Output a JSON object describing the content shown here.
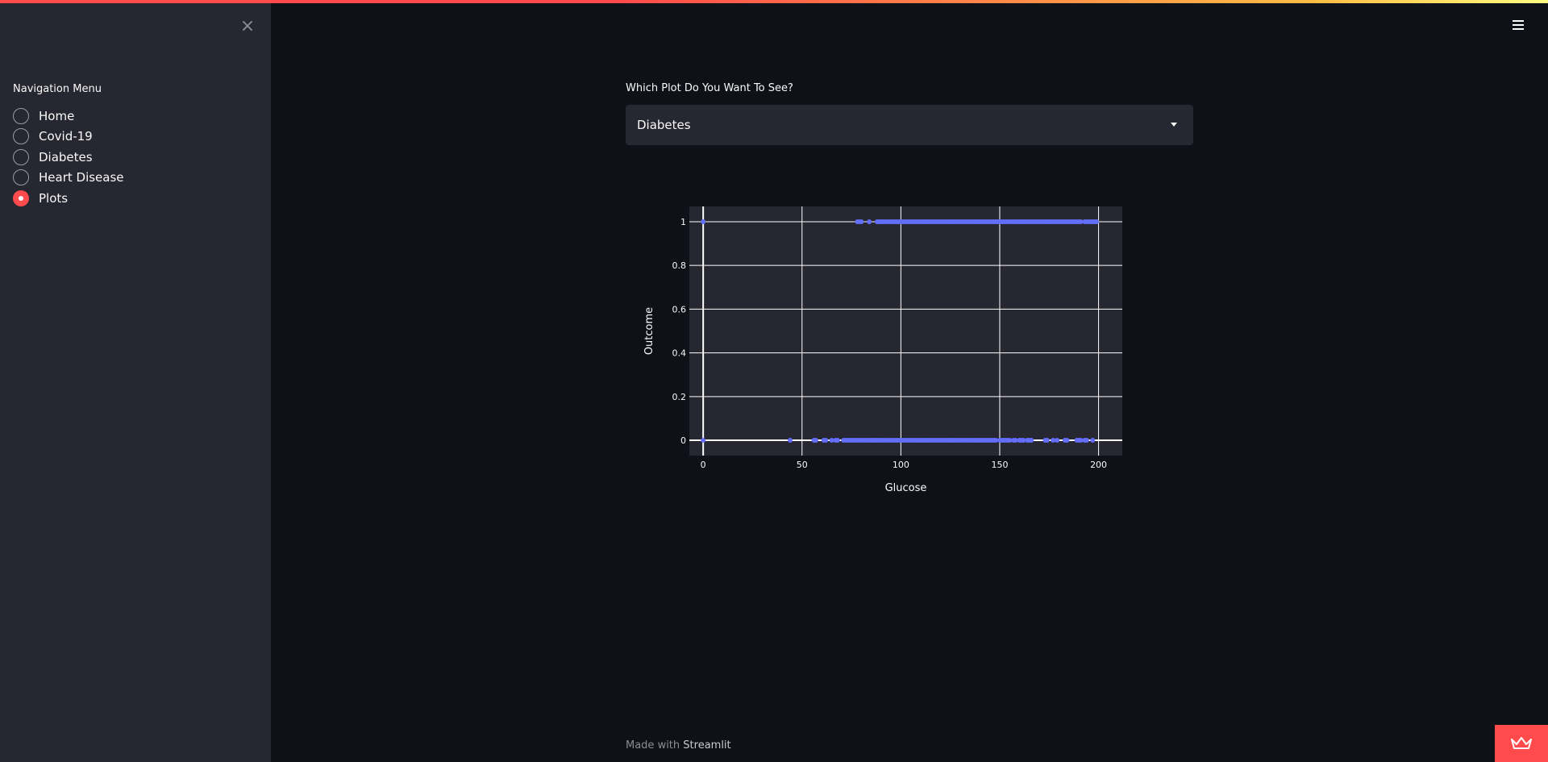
{
  "sidebar": {
    "close_glyph": "×",
    "nav_heading": "Navigation Menu",
    "items": [
      {
        "label": "Home",
        "selected": false
      },
      {
        "label": "Covid-19",
        "selected": false
      },
      {
        "label": "Diabetes",
        "selected": false
      },
      {
        "label": "Heart Disease",
        "selected": false
      },
      {
        "label": "Plots",
        "selected": true
      }
    ]
  },
  "main": {
    "select_label": "Which Plot Do You Want To See?",
    "select_value": "Diabetes"
  },
  "chart_data": {
    "type": "scatter",
    "xlabel": "Glucose",
    "ylabel": "Outcome",
    "xlim": [
      -7,
      212
    ],
    "ylim": [
      -0.07,
      1.07
    ],
    "x_ticks": [
      0,
      50,
      100,
      150,
      200
    ],
    "y_ticks": [
      0,
      0.2,
      0.4,
      0.6,
      0.8,
      1
    ],
    "x_tick_labels": [
      "0",
      "50",
      "100",
      "150",
      "200"
    ],
    "y_tick_labels": [
      "0",
      "0.2",
      "0.4",
      "0.6",
      "0.8",
      "1"
    ],
    "grid": true,
    "series": [
      {
        "x": [
          0,
          78,
          79,
          80,
          84,
          88,
          89,
          90,
          91,
          92,
          93,
          94,
          95,
          96,
          97,
          98,
          99,
          100,
          101,
          102,
          103,
          104,
          105,
          106,
          107,
          108,
          109,
          110,
          111,
          112,
          113,
          114,
          115,
          116,
          117,
          118,
          119,
          120,
          121,
          122,
          123,
          124,
          125,
          126,
          127,
          128,
          129,
          130,
          131,
          132,
          133,
          134,
          135,
          136,
          137,
          138,
          139,
          140,
          141,
          142,
          143,
          144,
          145,
          146,
          147,
          148,
          149,
          150,
          151,
          152,
          153,
          154,
          155,
          156,
          157,
          158,
          159,
          160,
          161,
          162,
          163,
          164,
          165,
          166,
          167,
          168,
          169,
          170,
          171,
          172,
          173,
          174,
          175,
          176,
          177,
          178,
          179,
          180,
          181,
          182,
          183,
          184,
          185,
          186,
          187,
          188,
          189,
          190,
          191,
          193,
          194,
          195,
          196,
          197,
          198,
          199
        ],
        "y": [
          1,
          1,
          1,
          1,
          1,
          1,
          1,
          1,
          1,
          1,
          1,
          1,
          1,
          1,
          1,
          1,
          1,
          1,
          1,
          1,
          1,
          1,
          1,
          1,
          1,
          1,
          1,
          1,
          1,
          1,
          1,
          1,
          1,
          1,
          1,
          1,
          1,
          1,
          1,
          1,
          1,
          1,
          1,
          1,
          1,
          1,
          1,
          1,
          1,
          1,
          1,
          1,
          1,
          1,
          1,
          1,
          1,
          1,
          1,
          1,
          1,
          1,
          1,
          1,
          1,
          1,
          1,
          1,
          1,
          1,
          1,
          1,
          1,
          1,
          1,
          1,
          1,
          1,
          1,
          1,
          1,
          1,
          1,
          1,
          1,
          1,
          1,
          1,
          1,
          1,
          1,
          1,
          1,
          1,
          1,
          1,
          1,
          1,
          1,
          1,
          1,
          1,
          1,
          1,
          1,
          1,
          1,
          1,
          1,
          1,
          1,
          1,
          1,
          1,
          1,
          1
        ]
      },
      {
        "x": [
          0,
          44,
          56,
          57,
          61,
          62,
          65,
          67,
          68,
          71,
          72,
          73,
          74,
          75,
          76,
          77,
          78,
          79,
          80,
          81,
          82,
          83,
          84,
          85,
          86,
          87,
          88,
          89,
          90,
          91,
          92,
          93,
          94,
          95,
          96,
          97,
          98,
          99,
          100,
          101,
          102,
          103,
          104,
          105,
          106,
          107,
          108,
          109,
          110,
          111,
          112,
          113,
          114,
          115,
          116,
          117,
          118,
          119,
          120,
          121,
          122,
          123,
          124,
          125,
          126,
          127,
          128,
          129,
          130,
          131,
          132,
          133,
          134,
          135,
          136,
          137,
          138,
          139,
          140,
          141,
          142,
          143,
          144,
          145,
          146,
          147,
          148,
          150,
          151,
          152,
          153,
          154,
          155,
          157,
          158,
          160,
          161,
          162,
          164,
          165,
          166,
          173,
          174,
          177,
          179,
          183,
          184,
          189,
          190,
          191,
          193,
          194,
          197
        ],
        "y": [
          0,
          0,
          0,
          0,
          0,
          0,
          0,
          0,
          0,
          0,
          0,
          0,
          0,
          0,
          0,
          0,
          0,
          0,
          0,
          0,
          0,
          0,
          0,
          0,
          0,
          0,
          0,
          0,
          0,
          0,
          0,
          0,
          0,
          0,
          0,
          0,
          0,
          0,
          0,
          0,
          0,
          0,
          0,
          0,
          0,
          0,
          0,
          0,
          0,
          0,
          0,
          0,
          0,
          0,
          0,
          0,
          0,
          0,
          0,
          0,
          0,
          0,
          0,
          0,
          0,
          0,
          0,
          0,
          0,
          0,
          0,
          0,
          0,
          0,
          0,
          0,
          0,
          0,
          0,
          0,
          0,
          0,
          0,
          0,
          0,
          0,
          0,
          0,
          0,
          0,
          0,
          0,
          0,
          0,
          0,
          0,
          0,
          0,
          0,
          0,
          0,
          0,
          0,
          0,
          0,
          0,
          0,
          0,
          0,
          0,
          0,
          0,
          0
        ]
      }
    ],
    "colors": {
      "marker": "#636efa",
      "plot_bg": "#262730",
      "grid": "#ffffff",
      "text": "#fafafa"
    }
  },
  "footer": {
    "prefix": "Made with ",
    "link": "Streamlit"
  },
  "icons": {
    "close": "close-icon",
    "menu": "hamburger-menu-icon",
    "caret": "chevron-down-icon",
    "badge": "crown-icon"
  },
  "colors": {
    "accent": "#ff4b4b",
    "app_bg": "#0e1117",
    "sidebar_bg": "#262730"
  }
}
